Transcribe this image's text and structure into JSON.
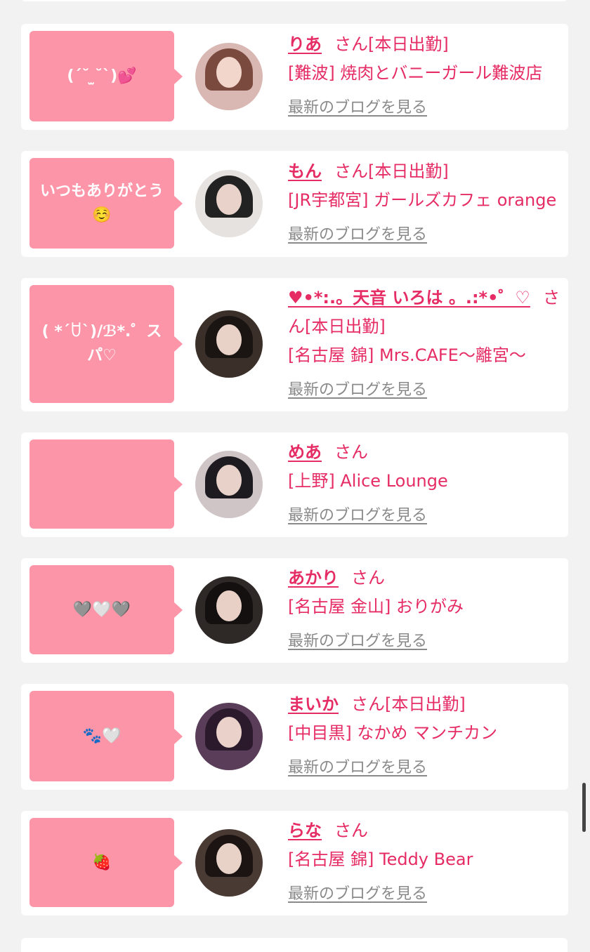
{
  "cards": [
    {
      "bubble": "(ˊ˘ ̫˘ˋ)💕",
      "name": "りあ",
      "san": "さん[本日出勤]",
      "shop": "[難波] 焼肉とバニーガール難波店",
      "blog": "最新のブログを見る",
      "avatar_colors": {
        "bg": "#d9b7b3",
        "hair": "#7a4a3e"
      }
    },
    {
      "bubble": "いつもありがとう☺️",
      "name": "もん",
      "san": "さん[本日出勤]",
      "shop": "[JR宇都宮] ガールズカフェ orange",
      "blog": "最新のブログを見る",
      "avatar_colors": {
        "bg": "#e6e2df",
        "hair": "#222222"
      }
    },
    {
      "bubble": "( *´ꇴ`)/ℬ*.゜スパ♡",
      "name": "♥•*:.。天音 いろは 。.:*•゜♡",
      "san": "さん[本日出勤]",
      "shop": "[名古屋 錦] Mrs.CAFE〜離宮〜",
      "blog": "最新のブログを見る",
      "avatar_colors": {
        "bg": "#3b2f2a",
        "hair": "#1a1412"
      }
    },
    {
      "bubble": "",
      "name": "めあ",
      "san": "さん",
      "shop": "[上野] Alice Lounge",
      "blog": "最新のブログを見る",
      "avatar_colors": {
        "bg": "#cfc4c6",
        "hair": "#1d1b1f"
      }
    },
    {
      "bubble": "🩶🤍🩶",
      "name": "あかり",
      "san": "さん",
      "shop": "[名古屋 金山] おりがみ",
      "blog": "最新のブログを見る",
      "avatar_colors": {
        "bg": "#2e2826",
        "hair": "#141010"
      }
    },
    {
      "bubble": "🐾🤍",
      "name": "まいか",
      "san": "さん[本日出勤]",
      "shop": "[中目黒] なかめ マンチカン",
      "blog": "最新のブログを見る",
      "avatar_colors": {
        "bg": "#5a3d58",
        "hair": "#2a1a2c"
      }
    },
    {
      "bubble": "🍓",
      "name": "らな",
      "san": "さん",
      "shop": "[名古屋 錦] Teddy Bear",
      "blog": "最新のブログを見る",
      "avatar_colors": {
        "bg": "#4a3a34",
        "hair": "#1c1412"
      }
    }
  ],
  "colors": {
    "accent": "#e62c64",
    "bubble": "#fd95a8",
    "link_gray": "#8a8a8a",
    "background": "#f2f2f2"
  }
}
